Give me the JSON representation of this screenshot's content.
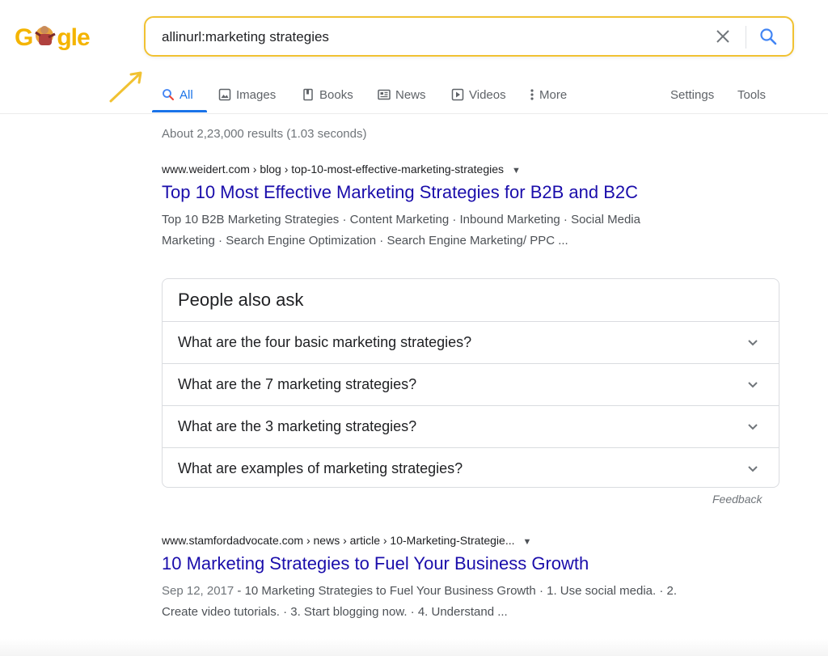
{
  "logo": {
    "text_a": "G",
    "text_b": "gle"
  },
  "search": {
    "query": "allinurl:marketing strategies"
  },
  "tabs": [
    {
      "label": "All",
      "icon": "search-icon"
    },
    {
      "label": "Images",
      "icon": "image-icon"
    },
    {
      "label": "Books",
      "icon": "book-icon"
    },
    {
      "label": "News",
      "icon": "news-icon"
    },
    {
      "label": "Videos",
      "icon": "play-icon"
    },
    {
      "label": "More",
      "icon": "more-dots-icon"
    }
  ],
  "tools": {
    "settings": "Settings",
    "tools": "Tools"
  },
  "stats": "About 2,23,000 results (1.03 seconds)",
  "results": [
    {
      "crumb": "www.weidert.com › blog › top-10-most-effective-marketing-strategies",
      "title": "Top 10 Most Effective Marketing Strategies for B2B and B2C",
      "snippet_line1": "Top 10 B2B Marketing Strategies · Content Marketing · Inbound Marketing · Social Media",
      "snippet_line2": "Marketing · Search Engine Optimization · Search Engine Marketing/ PPC ..."
    },
    {
      "crumb": "www.stamfordadvocate.com › news › article › 10-Marketing-Strategie...",
      "title": "10 Marketing Strategies to Fuel Your Business Growth",
      "date": "Sep 12, 2017",
      "snippet_line1": " - 10 Marketing Strategies to Fuel Your Business Growth · 1. Use social media. · 2.",
      "snippet_line2": "Create video tutorials. · 3. Start blogging now. · 4. Understand ..."
    }
  ],
  "paa": {
    "heading": "People also ask",
    "questions": [
      "What are the four basic marketing strategies?",
      "What are the 7 marketing strategies?",
      "What are the 3 marketing strategies?",
      "What are examples of marketing strategies?"
    ],
    "feedback": "Feedback"
  },
  "colors": {
    "link": "#1a0dab",
    "accent": "#1a73e8",
    "highlight": "#f1c232"
  }
}
